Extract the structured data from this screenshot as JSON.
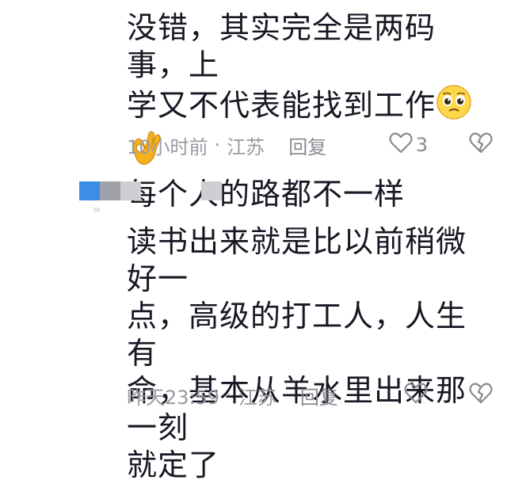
{
  "comment1": {
    "lines": [
      "没错，其实完全是两码事，上",
      "学又不代表能找到工作",
      "每个人的路都不一样"
    ],
    "emojis": [
      "pleading-face",
      "ok-hand"
    ],
    "time": "10小时前",
    "separator": "·",
    "location": "江苏",
    "reply": "回复",
    "likes": "3"
  },
  "comment2": {
    "author_redacted": true,
    "lines": [
      "读书出来就是比以前稍微好一",
      "点，高级的打工人，人生有",
      "命，基本从羊水里出来那一刻",
      "就定了"
    ],
    "time": "昨天23:59",
    "separator": "·",
    "location": "江苏",
    "reply": "回复"
  },
  "colors": {
    "meta": "#9a9ba3",
    "text": "#161823",
    "redact_blue": "#3b8de8",
    "redact_gray": "#cfcfd3"
  }
}
